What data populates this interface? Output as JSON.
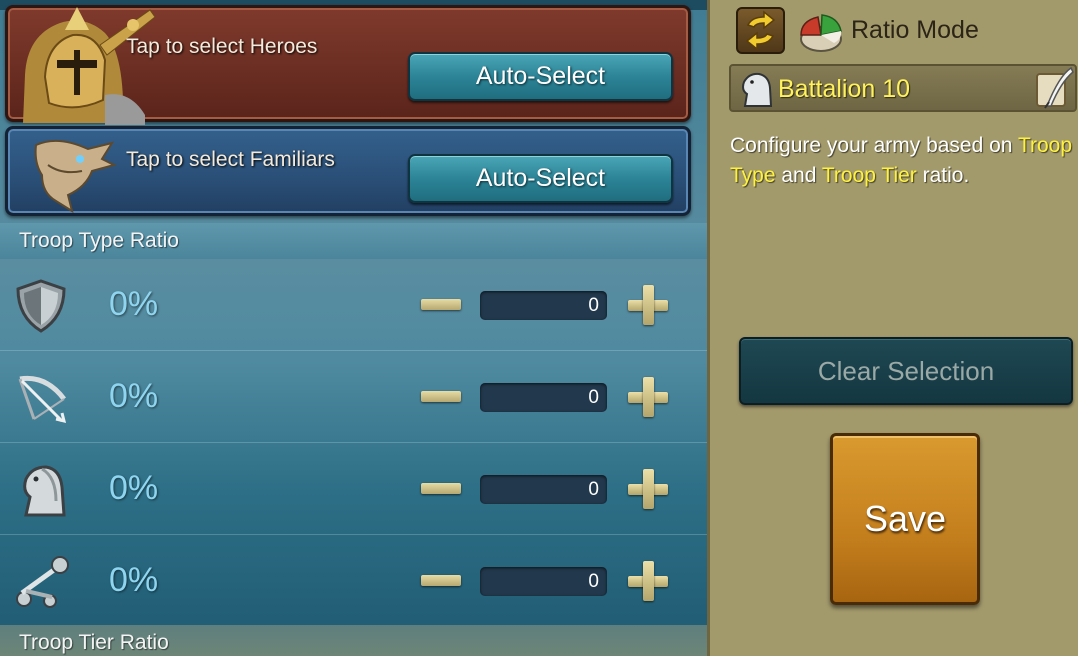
{
  "heroes": {
    "label": "Tap to select Heroes",
    "auto_select": "Auto-Select"
  },
  "familiars": {
    "label": "Tap to select Familiars",
    "auto_select": "Auto-Select"
  },
  "troop_type": {
    "header": "Troop Type Ratio",
    "rows": [
      {
        "icon": "infantry-shield-icon",
        "percent": "0%",
        "value": "0"
      },
      {
        "icon": "ranged-bow-icon",
        "percent": "0%",
        "value": "0"
      },
      {
        "icon": "cavalry-horse-icon",
        "percent": "0%",
        "value": "0"
      },
      {
        "icon": "siege-catapult-icon",
        "percent": "0%",
        "value": "0"
      }
    ]
  },
  "troop_tier": {
    "header": "Troop Tier Ratio"
  },
  "sidebar": {
    "mode_label": "Ratio Mode",
    "battalion": "Battalion 10",
    "description": {
      "part1": "Configure your army based on ",
      "highlight1": "Troop Type",
      "part2": " and ",
      "highlight2": "Troop Tier",
      "part3": " ratio."
    },
    "clear_label": "Clear Selection",
    "save_label": "Save"
  },
  "colors": {
    "highlight": "#fff23d",
    "save": "#c47f1d",
    "percent": "#8fd5ef"
  }
}
